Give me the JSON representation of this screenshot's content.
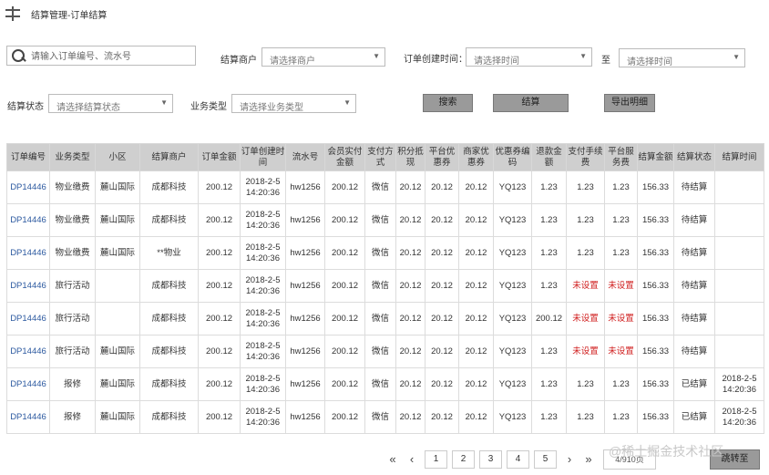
{
  "header": {
    "title": "结算管理-订单结算"
  },
  "filters": {
    "search_placeholder": "请输入订单编号、流水号",
    "merchant_label": "结算商户",
    "merchant_placeholder": "请选择商户",
    "created_label": "订单创建时间：",
    "time_start_placeholder": "请选择时间",
    "to_label": "至",
    "time_end_placeholder": "请选择时间",
    "status_label": "结算状态",
    "status_placeholder": "请选择结算状态",
    "biz_label": "业务类型",
    "biz_placeholder": "请选择业务类型",
    "search_button": "搜索",
    "settle_button": "结算",
    "export_button": "导出明细"
  },
  "table": {
    "headers": [
      "订单编号",
      "业务类型",
      "小区",
      "结算商户",
      "订单金额",
      "订单创建时间",
      "流水号",
      "会员实付金额",
      "支付方式",
      "积分抵现",
      "平台优惠券",
      "商家优惠券",
      "优惠券编码",
      "退款金额",
      "支付手续费",
      "平台服务费",
      "结算金额",
      "结算状态",
      "结算时间"
    ],
    "rows": [
      [
        "DP14446",
        "物业缴费",
        "麓山国际",
        "成都科技",
        "200.12",
        "2018-2-5 14:20:36",
        "hw1256",
        "200.12",
        "微信",
        "20.12",
        "20.12",
        "20.12",
        "YQ123",
        "1.23",
        "1.23",
        "1.23",
        "156.33",
        "待结算",
        ""
      ],
      [
        "DP14446",
        "物业缴费",
        "麓山国际",
        "成都科技",
        "200.12",
        "2018-2-5 14:20:36",
        "hw1256",
        "200.12",
        "微信",
        "20.12",
        "20.12",
        "20.12",
        "YQ123",
        "1.23",
        "1.23",
        "1.23",
        "156.33",
        "待结算",
        ""
      ],
      [
        "DP14446",
        "物业缴费",
        "麓山国际",
        "**物业",
        "200.12",
        "2018-2-5 14:20:36",
        "hw1256",
        "200.12",
        "微信",
        "20.12",
        "20.12",
        "20.12",
        "YQ123",
        "1.23",
        "1.23",
        "1.23",
        "156.33",
        "待结算",
        ""
      ],
      [
        "DP14446",
        "旅行活动",
        "",
        "成都科技",
        "200.12",
        "2018-2-5 14:20:36",
        "hw1256",
        "200.12",
        "微信",
        "20.12",
        "20.12",
        "20.12",
        "YQ123",
        "1.23",
        "未设置",
        "未设置",
        "156.33",
        "待结算",
        ""
      ],
      [
        "DP14446",
        "旅行活动",
        "",
        "成都科技",
        "200.12",
        "2018-2-5 14:20:36",
        "hw1256",
        "200.12",
        "微信",
        "20.12",
        "20.12",
        "20.12",
        "YQ123",
        "200.12",
        "未设置",
        "未设置",
        "156.33",
        "待结算",
        ""
      ],
      [
        "DP14446",
        "旅行活动",
        "麓山国际",
        "成都科技",
        "200.12",
        "2018-2-5 14:20:36",
        "hw1256",
        "200.12",
        "微信",
        "20.12",
        "20.12",
        "20.12",
        "YQ123",
        "1.23",
        "未设置",
        "未设置",
        "156.33",
        "待结算",
        ""
      ],
      [
        "DP14446",
        "报修",
        "麓山国际",
        "成都科技",
        "200.12",
        "2018-2-5 14:20:36",
        "hw1256",
        "200.12",
        "微信",
        "20.12",
        "20.12",
        "20.12",
        "YQ123",
        "1.23",
        "1.23",
        "1.23",
        "156.33",
        "已结算",
        "2018-2-5 14:20:36"
      ],
      [
        "DP14446",
        "报修",
        "麓山国际",
        "成都科技",
        "200.12",
        "2018-2-5 14:20:36",
        "hw1256",
        "200.12",
        "微信",
        "20.12",
        "20.12",
        "20.12",
        "YQ123",
        "1.23",
        "1.23",
        "1.23",
        "156.33",
        "已结算",
        "2018-2-5 14:20:36"
      ]
    ]
  },
  "pagination": {
    "first": "«",
    "prev": "‹",
    "pages": [
      "1",
      "2",
      "3",
      "4",
      "5"
    ],
    "next": "›",
    "last": "»",
    "page_total": "4/910页",
    "jump_button": "跳转至"
  },
  "watermark": "@稀土掘金技术社区",
  "colors": {
    "link": "#2d5aa0",
    "warning": "#d02020",
    "header_bg": "#cfcfcf",
    "button_bg": "#9a9a9a"
  }
}
